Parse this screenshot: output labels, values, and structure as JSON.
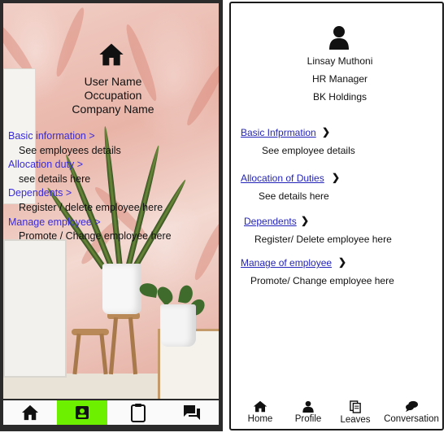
{
  "left_mockup": {
    "user_name": "User Name",
    "occupation": "Occupation",
    "company_name": "Company Name",
    "menu": [
      {
        "link": "Basic information >",
        "desc": "See employees details"
      },
      {
        "link": "Allocation duty >",
        "desc": "see details here"
      },
      {
        "link": "Dependents >",
        "desc": "Register / delete employee here"
      },
      {
        "link": "Manage employee >",
        "desc": "Promote / Change employee here"
      }
    ],
    "nav": [
      {
        "icon": "home-icon"
      },
      {
        "icon": "profile-badge-icon",
        "active": true
      },
      {
        "icon": "clipboard-icon"
      },
      {
        "icon": "chat-icon"
      }
    ],
    "active_color": "#6cf000",
    "link_color": "#3a2bd9"
  },
  "right_mockup": {
    "user_name": "Linsay Muthoni",
    "occupation": "HR Manager",
    "company_name": "BK Holdings",
    "menu": [
      {
        "link": "Basic Infprmation",
        "desc": "See employee details"
      },
      {
        "link": "Allocation of Duties",
        "desc": "See details here"
      },
      {
        "link": "Dependents",
        "desc": "Register/ Delete employee here"
      },
      {
        "link": "Manage of employee",
        "desc": "Promote/ Change employee here"
      }
    ],
    "nav": [
      {
        "label": "Home",
        "icon": "home-icon"
      },
      {
        "label": "Profile",
        "icon": "person-icon"
      },
      {
        "label": "Leaves",
        "icon": "documents-icon"
      },
      {
        "label": "Conversation",
        "icon": "chat-bubbles-icon"
      }
    ],
    "link_color": "#2424b8"
  }
}
